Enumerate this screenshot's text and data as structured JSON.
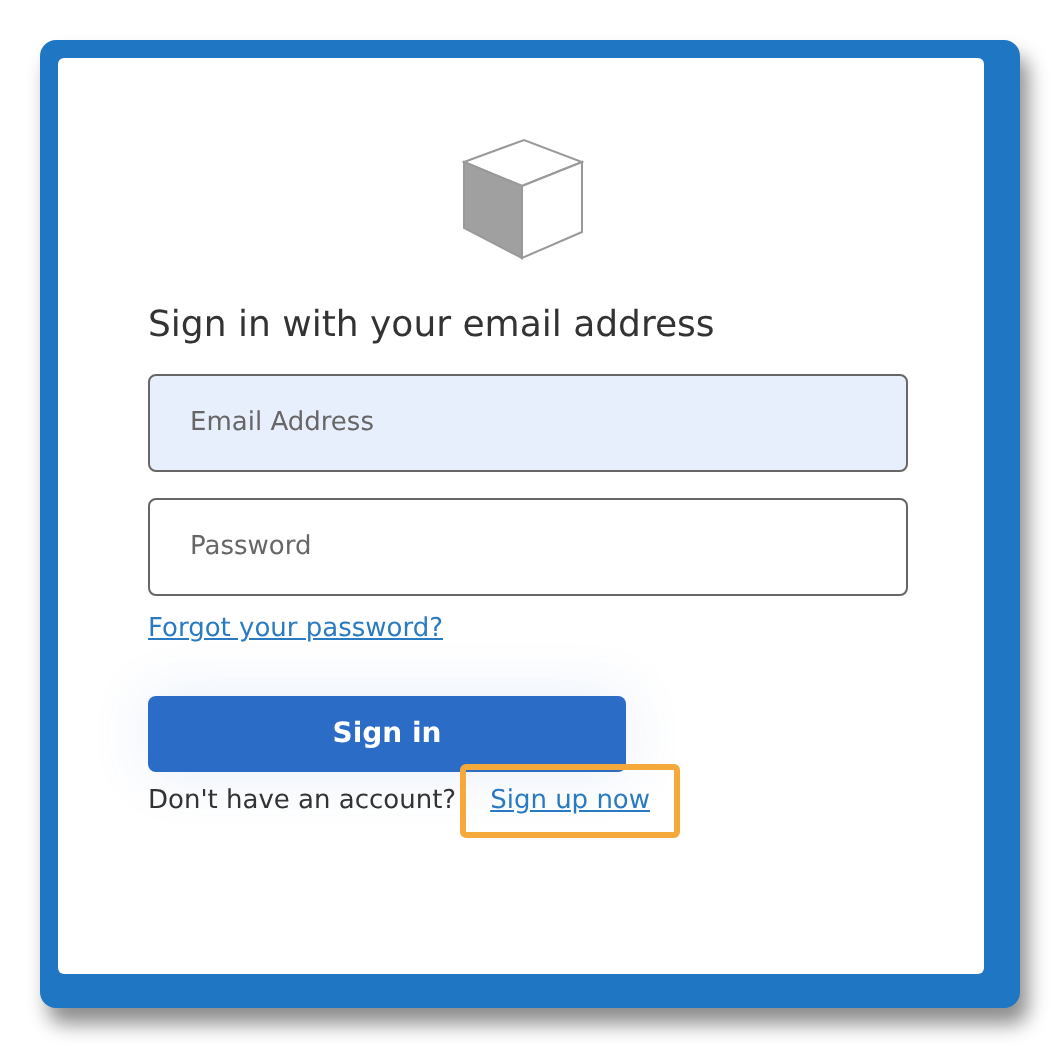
{
  "heading": "Sign in with your email address",
  "fields": [
    {
      "placeholder": "Email Address",
      "filled": true
    },
    {
      "placeholder": "Password",
      "filled": false
    }
  ],
  "forgot_link": "Forgot your password?",
  "sign_in_button": "Sign in",
  "signup_prompt": "Don't have an account?",
  "signup_link": {
    "label": "Sign up now",
    "highlighted": true
  }
}
